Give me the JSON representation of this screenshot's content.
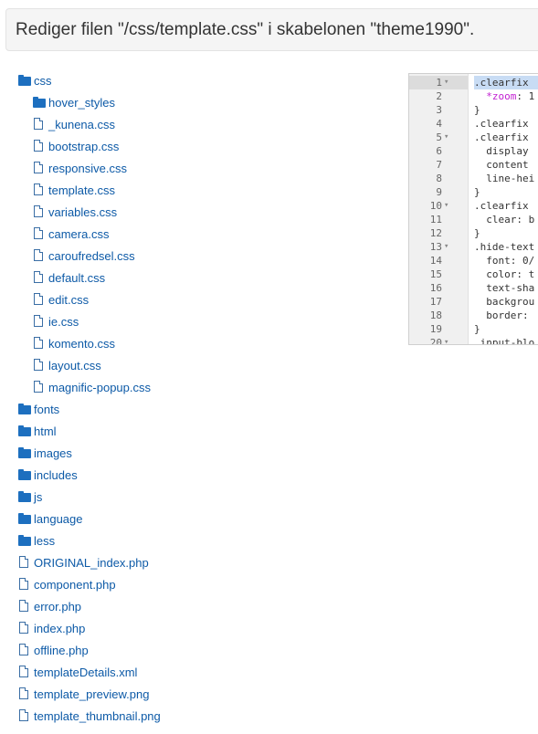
{
  "header": {
    "title": "Rediger filen \"/css/template.css\" i skabelonen \"theme1990\"."
  },
  "tree": {
    "items": [
      {
        "type": "folder",
        "label": "css",
        "level": 0
      },
      {
        "type": "folder",
        "label": "hover_styles",
        "level": 1
      },
      {
        "type": "file",
        "label": "_kunena.css",
        "level": 1
      },
      {
        "type": "file",
        "label": "bootstrap.css",
        "level": 1
      },
      {
        "type": "file",
        "label": "responsive.css",
        "level": 1
      },
      {
        "type": "file",
        "label": "template.css",
        "level": 1
      },
      {
        "type": "file",
        "label": "variables.css",
        "level": 1
      },
      {
        "type": "file",
        "label": "camera.css",
        "level": 1
      },
      {
        "type": "file",
        "label": "caroufredsel.css",
        "level": 1
      },
      {
        "type": "file",
        "label": "default.css",
        "level": 1
      },
      {
        "type": "file",
        "label": "edit.css",
        "level": 1
      },
      {
        "type": "file",
        "label": "ie.css",
        "level": 1
      },
      {
        "type": "file",
        "label": "komento.css",
        "level": 1
      },
      {
        "type": "file",
        "label": "layout.css",
        "level": 1
      },
      {
        "type": "file",
        "label": "magnific-popup.css",
        "level": 1
      },
      {
        "type": "folder",
        "label": "fonts",
        "level": 0
      },
      {
        "type": "folder",
        "label": "html",
        "level": 0
      },
      {
        "type": "folder",
        "label": "images",
        "level": 0
      },
      {
        "type": "folder",
        "label": "includes",
        "level": 0
      },
      {
        "type": "folder",
        "label": "js",
        "level": 0
      },
      {
        "type": "folder",
        "label": "language",
        "level": 0
      },
      {
        "type": "folder",
        "label": "less",
        "level": 0
      },
      {
        "type": "file",
        "label": "ORIGINAL_index.php",
        "level": 0
      },
      {
        "type": "file",
        "label": "component.php",
        "level": 0
      },
      {
        "type": "file",
        "label": "error.php",
        "level": 0
      },
      {
        "type": "file",
        "label": "index.php",
        "level": 0
      },
      {
        "type": "file",
        "label": "offline.php",
        "level": 0
      },
      {
        "type": "file",
        "label": "templateDetails.xml",
        "level": 0
      },
      {
        "type": "file",
        "label": "template_preview.png",
        "level": 0
      },
      {
        "type": "file",
        "label": "template_thumbnail.png",
        "level": 0
      }
    ]
  },
  "editor": {
    "lines": [
      {
        "num": "1",
        "fold": "▾",
        "text": ".clearfix"
      },
      {
        "num": "2",
        "fold": "",
        "text": "  *zoom: 1"
      },
      {
        "num": "3",
        "fold": "",
        "text": "}"
      },
      {
        "num": "4",
        "fold": "",
        "text": ".clearfix"
      },
      {
        "num": "5",
        "fold": "▾",
        "text": ".clearfix"
      },
      {
        "num": "6",
        "fold": "",
        "text": "  display"
      },
      {
        "num": "7",
        "fold": "",
        "text": "  content"
      },
      {
        "num": "8",
        "fold": "",
        "text": "  line-hei"
      },
      {
        "num": "9",
        "fold": "",
        "text": "}"
      },
      {
        "num": "10",
        "fold": "▾",
        "text": ".clearfix"
      },
      {
        "num": "11",
        "fold": "",
        "text": "  clear: b"
      },
      {
        "num": "12",
        "fold": "",
        "text": "}"
      },
      {
        "num": "13",
        "fold": "▾",
        "text": ".hide-text"
      },
      {
        "num": "14",
        "fold": "",
        "text": "  font: 0/"
      },
      {
        "num": "15",
        "fold": "",
        "text": "  color: t"
      },
      {
        "num": "16",
        "fold": "",
        "text": "  text-sha"
      },
      {
        "num": "17",
        "fold": "",
        "text": "  backgrou"
      },
      {
        "num": "18",
        "fold": "",
        "text": "  border: "
      },
      {
        "num": "19",
        "fold": "",
        "text": "}"
      },
      {
        "num": "20",
        "fold": "▾",
        "text": ".input-blo"
      }
    ]
  }
}
